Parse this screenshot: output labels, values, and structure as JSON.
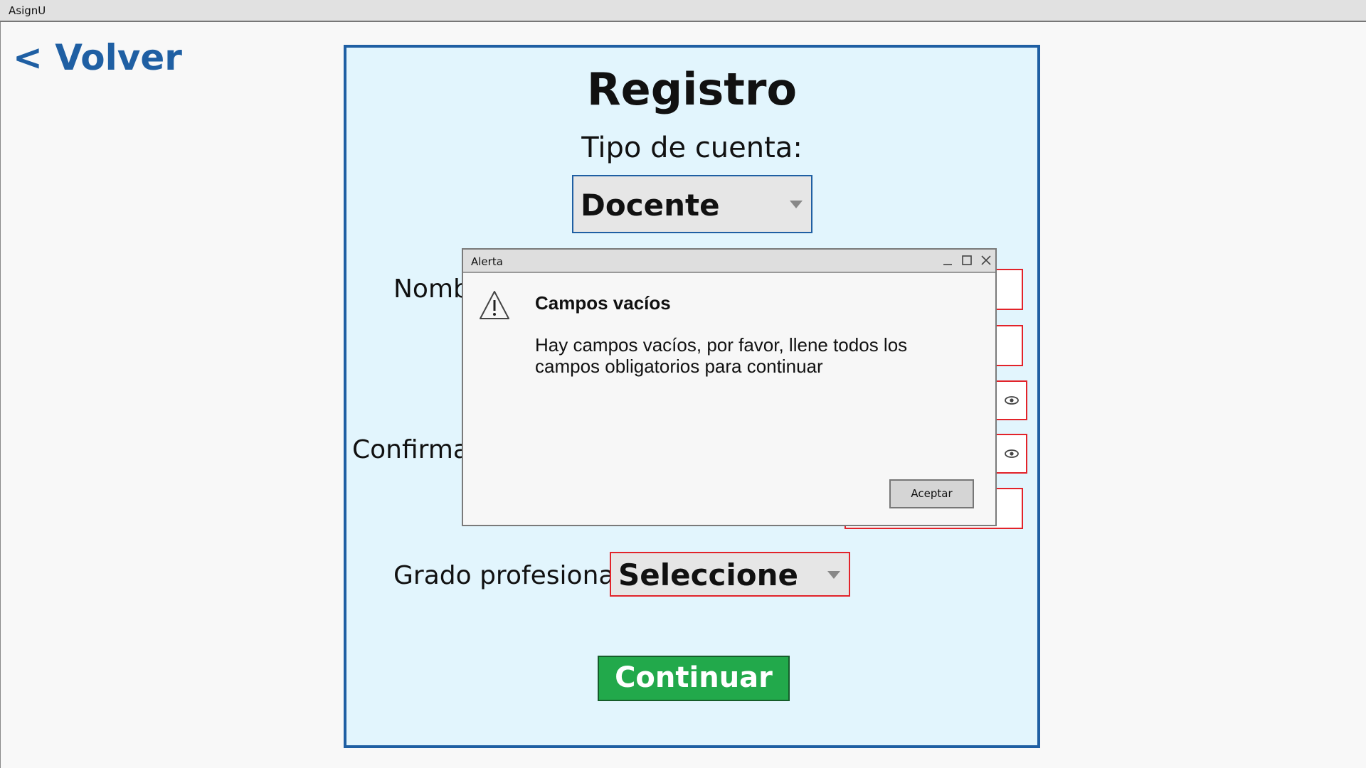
{
  "app": {
    "title": "AsignU"
  },
  "nav": {
    "back_label": "< Volver"
  },
  "form": {
    "title": "Registro",
    "account_type_label": "Tipo de cuenta:",
    "account_type_value": "Docente",
    "name_label_partial": "Nombr",
    "confirm_label_partial": "Confirmar",
    "grade_label": "Grado profesional:",
    "grade_value": "Seleccione",
    "continue_label": "Continuar"
  },
  "dialog": {
    "window_title": "Alerta",
    "heading": "Campos vacíos",
    "message": "Hay campos vacíos, por favor, llene todos los campos obligatorios para continuar",
    "accept_label": "Aceptar"
  },
  "colors": {
    "accent_blue": "#1f5fa3",
    "panel_bg": "#e2f5fd",
    "error_red": "#e2232a",
    "continue_green": "#22a94b"
  }
}
